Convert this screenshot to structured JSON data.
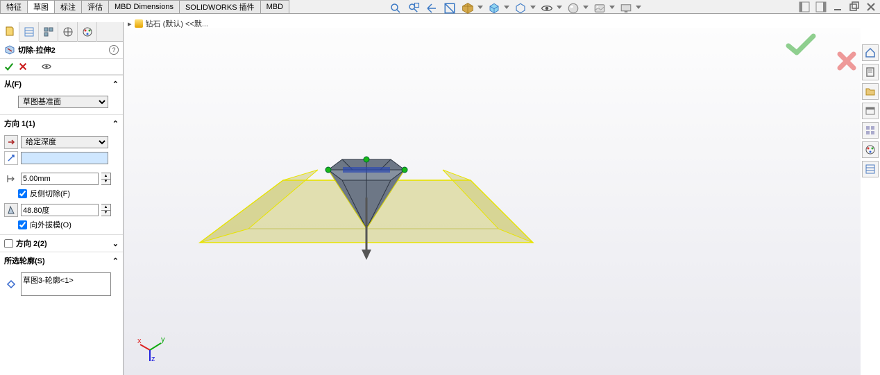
{
  "tabs": {
    "items": [
      "特征",
      "草图",
      "标注",
      "评估",
      "MBD Dimensions",
      "SOLIDWORKS 插件",
      "MBD"
    ],
    "active_index": 1
  },
  "breadcrumb": {
    "doc_name": "钻石 (默认) <<默..."
  },
  "feature": {
    "title": "切除-拉伸2",
    "from_section": "从(F)",
    "from_plane": "草图基准面",
    "dir1_section": "方向 1(1)",
    "end_condition": "给定深度",
    "depth_value": "5.00mm",
    "flip_side_label": "反侧切除(F)",
    "flip_side_checked": true,
    "draft_angle": "48.80度",
    "draft_outward_label": "向外拔模(O)",
    "draft_outward_checked": true,
    "dir2_section": "方向 2(2)",
    "dir2_checked": false,
    "contours_section": "所选轮廓(S)",
    "contour_item": "草图3-轮廓<1>",
    "angle_field_value": ""
  },
  "panel_tabs": [
    "feature-manager",
    "property-manager",
    "config-manager",
    "dimxpert",
    "appearances"
  ]
}
